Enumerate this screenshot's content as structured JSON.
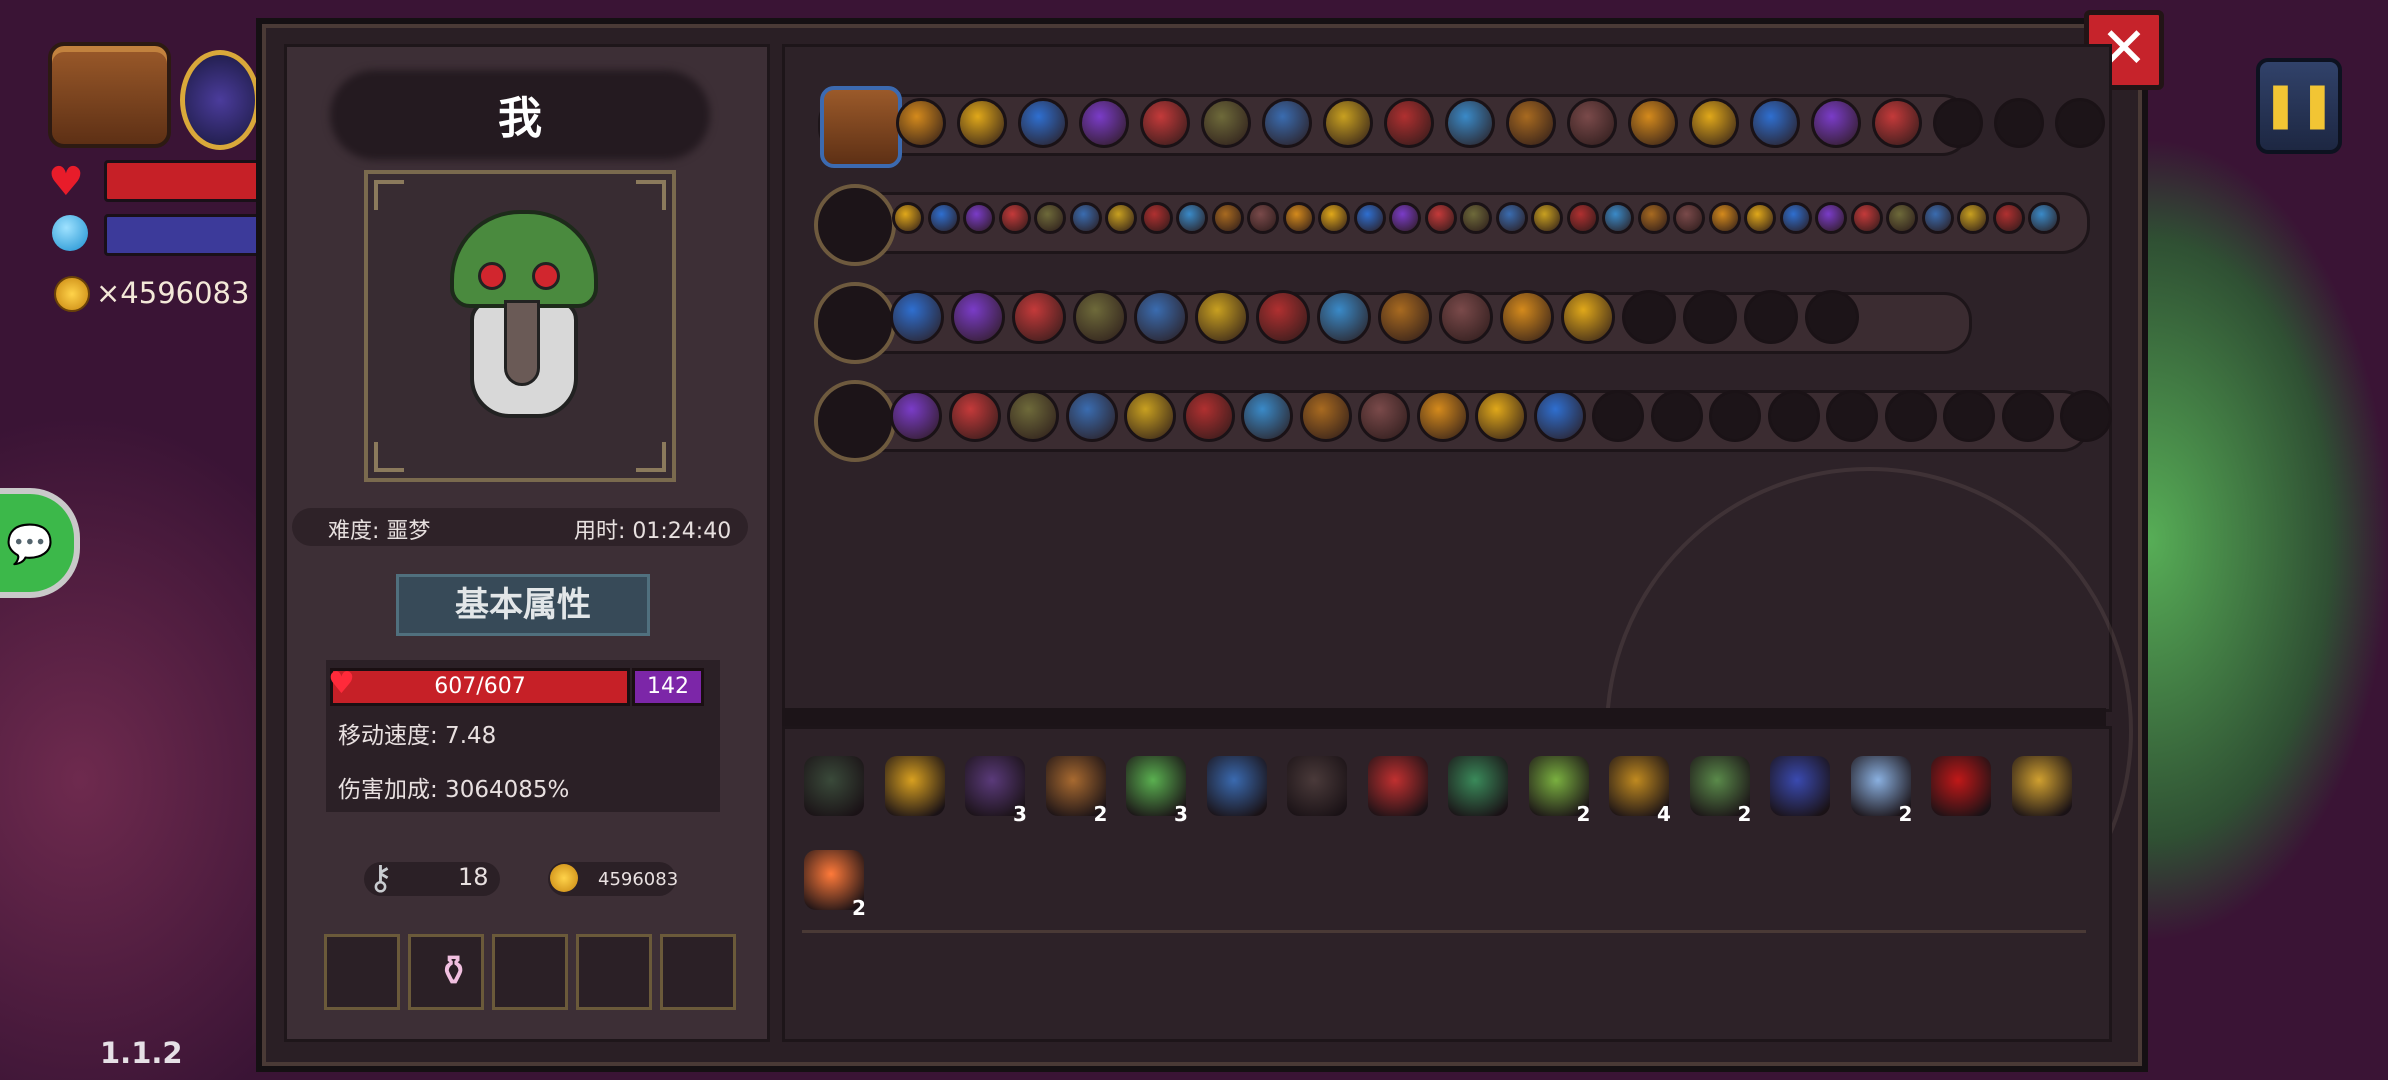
{
  "hud": {
    "coin_count": "×4596083",
    "version": "1.1.2",
    "pause_icon": "pause-icon",
    "hp_color": "#c62027",
    "mp_color": "#3c3a9a"
  },
  "panel": {
    "close_icon": "close-icon",
    "player_name": "我",
    "difficulty": "难度: 噩梦",
    "time_used": "用时: 01:24:40",
    "section_title": "基本属性",
    "hp_text": "607/607",
    "shield_text": "142",
    "move_speed": "移动速度: 7.48",
    "damage_bonus": "伤害加成: 3064085%",
    "keys": "18",
    "gold": "4596083"
  },
  "skill_rows": [
    {
      "name": "chest-row",
      "icon_count": 17,
      "empty_count": 3
    },
    {
      "name": "staff-row",
      "icon_count": 33,
      "empty_count": 0
    },
    {
      "name": "spear-row",
      "icon_count": 12,
      "empty_count": 4
    },
    {
      "name": "axe-row",
      "icon_count": 12,
      "empty_count": 9
    }
  ],
  "items": [
    {
      "icon": "plague-mask-icon",
      "count": ""
    },
    {
      "icon": "golden-chalice-icon",
      "count": ""
    },
    {
      "icon": "cloak-icon",
      "count": "3"
    },
    {
      "icon": "scroll-icon",
      "count": "2"
    },
    {
      "icon": "syringe-icon",
      "count": "3"
    },
    {
      "icon": "crystal-amulet-icon",
      "count": ""
    },
    {
      "icon": "armor-icon",
      "count": ""
    },
    {
      "icon": "red-key-icon",
      "count": ""
    },
    {
      "icon": "green-helmet-icon",
      "count": ""
    },
    {
      "icon": "leaf-wing-icon",
      "count": "2"
    },
    {
      "icon": "pickaxe-icon",
      "count": "4"
    },
    {
      "icon": "plant-icon",
      "count": "2"
    },
    {
      "icon": "gauntlet-icon",
      "count": ""
    },
    {
      "icon": "mirror-icon",
      "count": "2"
    },
    {
      "icon": "red-eye-icon",
      "count": ""
    },
    {
      "icon": "magnifier-icon",
      "count": ""
    },
    {
      "icon": "heart-icon",
      "count": "2"
    }
  ]
}
